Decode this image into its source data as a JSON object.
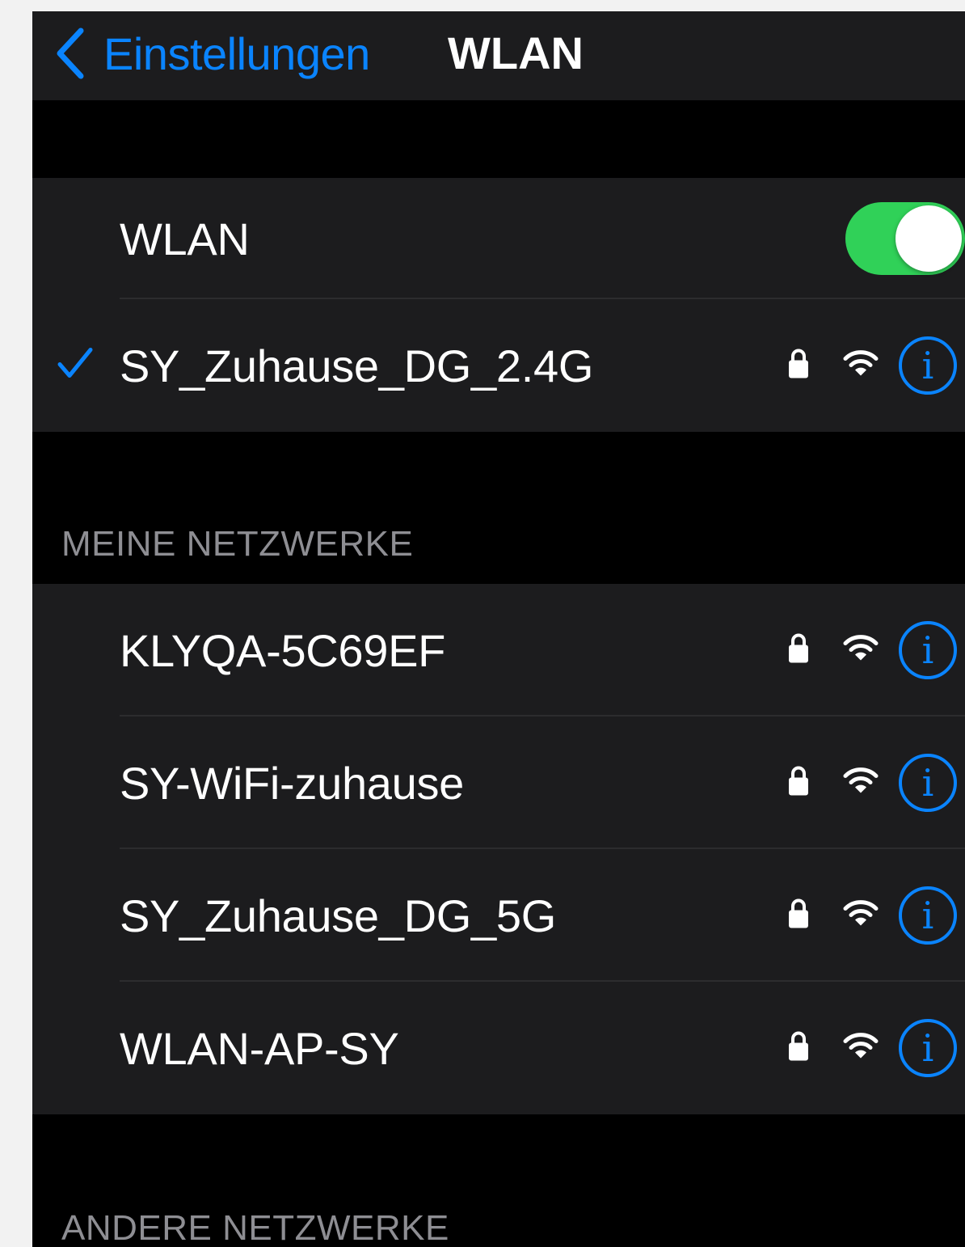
{
  "navbar": {
    "back_label": "Einstellungen",
    "title": "WLAN",
    "back_icon": "chevron-left-icon"
  },
  "wifi_toggle": {
    "label": "WLAN",
    "state": "on",
    "on_color": "#30d158"
  },
  "connected_network": {
    "name": "SY_Zuhause_DG_2.4G",
    "selected": true,
    "secured": true
  },
  "my_networks": {
    "header": "MEINE NETZWERKE",
    "items": [
      {
        "name": "KLYQA-5C69EF",
        "secured": true
      },
      {
        "name": "SY-WiFi-zuhause",
        "secured": true
      },
      {
        "name": "SY_Zuhause_DG_5G",
        "secured": true
      },
      {
        "name": "WLAN-AP-SY",
        "secured": true
      }
    ]
  },
  "other_networks": {
    "header": "ANDERE NETZWERKE"
  },
  "info_symbol": "i",
  "colors": {
    "accent": "#0a84ff",
    "background": "#000000",
    "cell": "#1c1c1e",
    "secondary_text": "#8e8e93"
  }
}
